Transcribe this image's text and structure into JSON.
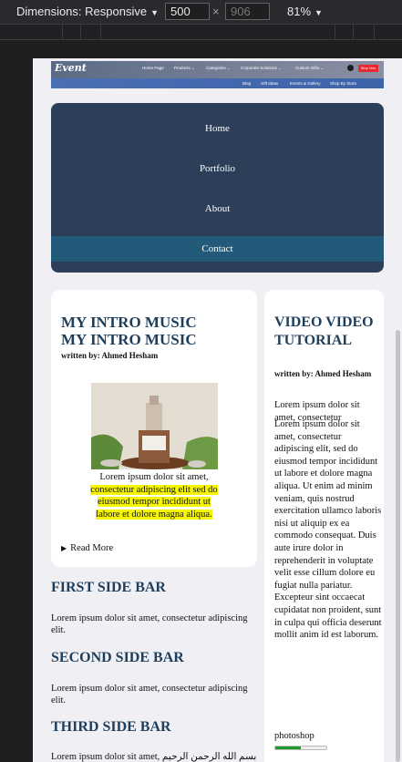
{
  "devtools": {
    "dimensions_label": "Dimensions: Responsive",
    "width_value": "500",
    "height_placeholder": "906",
    "times_sign": "×",
    "zoom_label": "81%",
    "caret": "▼"
  },
  "site_header": {
    "logo": "Event",
    "top_nav": [
      "Home Page",
      "Products ⌄",
      "Categories ⌄",
      "Corporate Solutions ⌄",
      "Custom Gifts ⌄"
    ],
    "button": "Shop Now",
    "bottom_nav": [
      "Blog",
      "Gift Ideas",
      "Events & Gallery",
      "Shop By Store"
    ]
  },
  "menu": {
    "items": [
      "Home",
      "Portfolio",
      "About",
      "Contact"
    ],
    "active_index": 3
  },
  "main_card": {
    "title_line1": "MY INTRO MUSIC",
    "title_line2": "MY INTRO MUSIC",
    "byline": "written by: Ahmed Hesham",
    "body_plain": "Lorem ipsum dolor sit amet,",
    "body_highlight": "consectetur adipiscing elit sed do eiusmod tempor incididunt ut labore et dolore magna aliqua.",
    "read_more": "Read More",
    "read_more_marker": "▶"
  },
  "sidebars": [
    {
      "title": "FIRST SIDE BAR",
      "text": "Lorem ipsum dolor sit amet, consectetur adipiscing elit."
    },
    {
      "title": "SECOND SIDE BAR",
      "text": "Lorem ipsum dolor sit amet, consectetur adipiscing elit."
    },
    {
      "title": "THIRD SIDE BAR",
      "text": "Lorem ipsum dolor sit amet, بسم الله الرحمن الرحيم"
    }
  ],
  "right_card": {
    "title": "VIDEO VIDEO TUTORIAL",
    "byline": "written by: Ahmed Hesham",
    "para_overlap": "Lorem ipsum dolor sit amet, consectetur",
    "para_main": "Lorem ipsum dolor sit amet, consectetur adipiscing elit, sed do eiusmod tempor incididunt ut labore et dolore magna aliqua. Ut enim ad minim veniam, quis nostrud exercitation ullamco laboris nisi ut aliquip ex ea commodo consequat. Duis aute irure dolor in reprehenderit in voluptate velit esse cillum dolore eu fugiat nulla pariatur. Excepteur sint occaecat cupidatat non proident, sunt in culpa qui officia deserunt mollit anim id est laborum.",
    "skill_label": "photoshop",
    "skill_level_percent": 50,
    "skill_color": "#1d9a2c"
  }
}
